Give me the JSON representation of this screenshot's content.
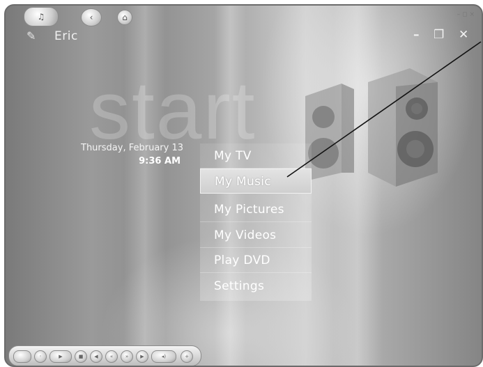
{
  "user": {
    "name": "Eric",
    "icon": "pencil-icon"
  },
  "window_controls": {
    "minimize": "–",
    "restore": "❐",
    "close": "✕"
  },
  "small_controls": "– ◻ ×",
  "background_word": "start",
  "datetime": {
    "date": "Thursday, February 13",
    "time": "9:36 AM"
  },
  "menu": {
    "selected": "My Music",
    "items": [
      {
        "label": "My TV"
      },
      {
        "label": "My Music"
      },
      {
        "label": "My Pictures"
      },
      {
        "label": "My Videos"
      },
      {
        "label": "Play DVD"
      },
      {
        "label": "Settings"
      }
    ]
  },
  "transport": {
    "left_button": "◦",
    "right_button": "+"
  },
  "colors": {
    "background": "#9a9a9a",
    "menu_text": "#ffffff",
    "selected_item": "#d8d8d8"
  }
}
